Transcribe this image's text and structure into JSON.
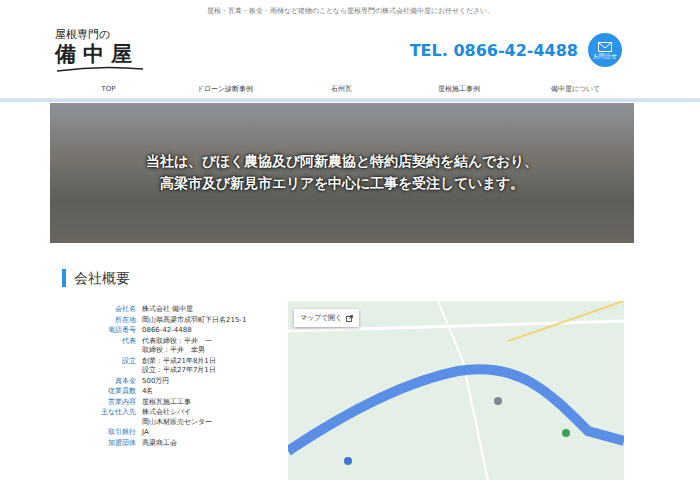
{
  "header": {
    "tagline": "屋根・瓦葺・板金・雨樋など建物のことなら屋根専門の株式会社備中屋にお任せください。",
    "logo": {
      "sub": "屋根専門の",
      "main": "備中屋"
    },
    "tel": "TEL. 0866-42-4488",
    "contact": "お問合せ"
  },
  "nav": [
    {
      "label": "TOP",
      "selected": false
    },
    {
      "label": "ドローン診断事例",
      "selected": false
    },
    {
      "label": "石州瓦",
      "selected": false
    },
    {
      "label": "屋根施工事例",
      "selected": false
    },
    {
      "label": "備中屋について",
      "selected": false
    }
  ],
  "hero": {
    "lines": [
      "当社は、びほく農協及び阿新農協と特約店契約を結んでおり、",
      "高梁市及び新見市エリアを中心に工事を受注しています。"
    ]
  },
  "section": {
    "title": "会社概要"
  },
  "profile": [
    {
      "label": "会社名",
      "values": [
        "株式会社 備中屋"
      ]
    },
    {
      "label": "所在地",
      "values": [
        "岡山県高梁市成羽町下日名215-1"
      ]
    },
    {
      "label": "電話番号",
      "values": [
        "0866-42-4488"
      ]
    },
    {
      "label": "代表",
      "values": [
        "代表取締役：平井　一",
        "取締役：平井　幸男"
      ]
    },
    {
      "label": "設立",
      "values": [
        "創業：平成21年8月1日",
        "設立：平成27年7月1日"
      ]
    },
    {
      "label": "資本金",
      "values": [
        "500万円"
      ]
    },
    {
      "label": "従業員数",
      "values": [
        "4名"
      ]
    },
    {
      "label": "営業内容",
      "values": [
        "屋根瓦施工工事"
      ]
    },
    {
      "label": "主な仕入先",
      "values": [
        "株式会社シバイ",
        "岡山木材販売センター"
      ]
    },
    {
      "label": "取引銀行",
      "values": [
        "JA"
      ]
    },
    {
      "label": "加盟団体",
      "values": [
        "高梁商工会"
      ]
    }
  ],
  "map": {
    "button": "マップで開く"
  }
}
